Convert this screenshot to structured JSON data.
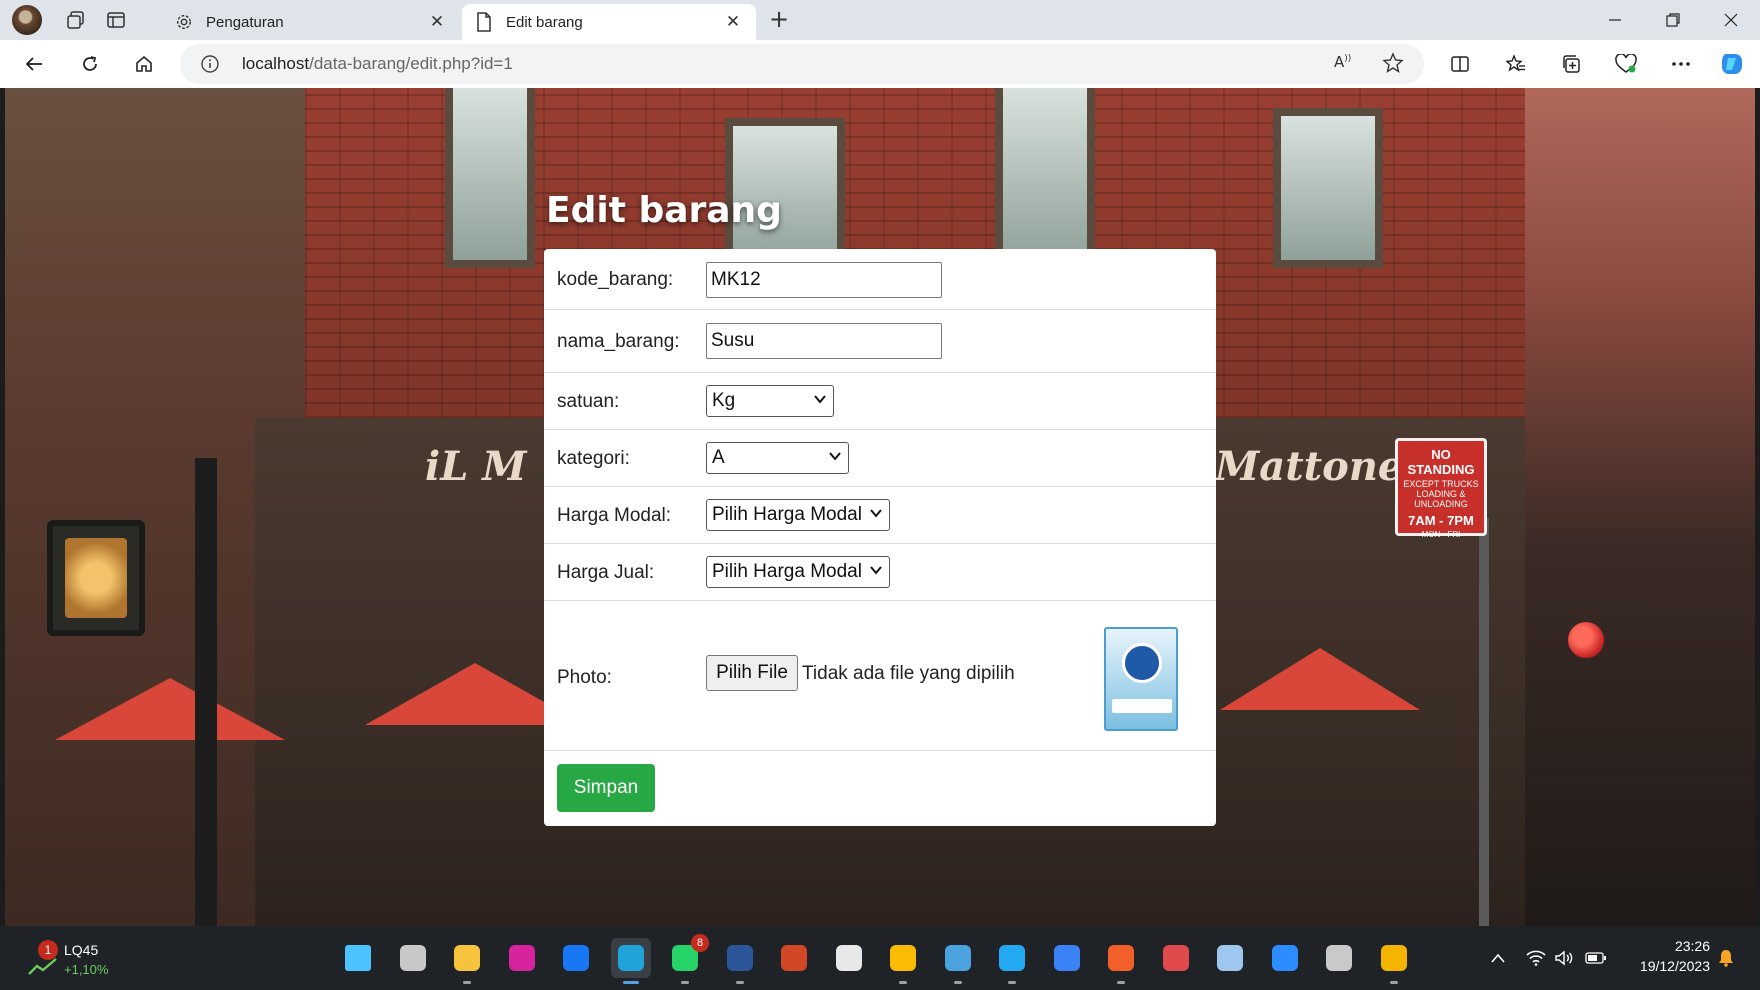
{
  "browser": {
    "tabs": [
      {
        "title": "Pengaturan",
        "icon": "gear-icon",
        "active": false
      },
      {
        "title": "Edit barang",
        "icon": "page-icon",
        "active": true
      }
    ],
    "url_host": "localhost",
    "url_path": "/data-barang/edit.php?id=1"
  },
  "page": {
    "title": "Edit barang",
    "form": {
      "kode_barang": {
        "label": "kode_barang:",
        "value": "MK12"
      },
      "nama_barang": {
        "label": "nama_barang:",
        "value": "Susu"
      },
      "satuan": {
        "label": "satuan:",
        "selected": "Kg"
      },
      "kategori": {
        "label": "kategori:",
        "selected": "A"
      },
      "harga_modal": {
        "label": "Harga Modal:",
        "selected": "Pilih Harga Modal"
      },
      "harga_jual": {
        "label": "Harga Jual:",
        "selected": "Pilih Harga Modal"
      },
      "photo": {
        "label": "Photo:",
        "button": "Pilih File",
        "status": "Tidak ada file yang dipilih"
      },
      "submit": "Simpan"
    },
    "background_signs": {
      "left": "iL M",
      "right": "Mattone",
      "no_standing": [
        "NO STANDING",
        "EXCEPT TRUCKS LOADING & UNLOADING",
        "7AM - 7PM",
        "MON - FRI"
      ]
    }
  },
  "taskbar": {
    "stock": {
      "name": "LQ45",
      "change": "+1,10%",
      "badge": "1"
    },
    "apps": [
      {
        "name": "start",
        "color": "#4cc2ff"
      },
      {
        "name": "task-view",
        "color": "#c8c8c8"
      },
      {
        "name": "file-explorer",
        "color": "#f6c33c"
      },
      {
        "name": "instagram",
        "color": "#d6249f"
      },
      {
        "name": "facebook",
        "color": "#1877f2"
      },
      {
        "name": "edge",
        "color": "#1fa3d9",
        "active": true
      },
      {
        "name": "whatsapp",
        "color": "#25d366",
        "badge": "8"
      },
      {
        "name": "word",
        "color": "#2b579a"
      },
      {
        "name": "powerpoint",
        "color": "#d24726"
      },
      {
        "name": "store",
        "color": "#e8e8e8"
      },
      {
        "name": "chrome",
        "color": "#fbbc05"
      },
      {
        "name": "cloud",
        "color": "#4aa3df"
      },
      {
        "name": "vscode",
        "color": "#23a9f2"
      },
      {
        "name": "app-a",
        "color": "#3b82f6"
      },
      {
        "name": "paint",
        "color": "#f2602a"
      },
      {
        "name": "git",
        "color": "#e04a4a"
      },
      {
        "name": "cube",
        "color": "#9ec7f0"
      },
      {
        "name": "zoom",
        "color": "#2d8cff"
      },
      {
        "name": "obs",
        "color": "#c9c9c9"
      },
      {
        "name": "diamond-app",
        "color": "#f4b400"
      }
    ],
    "time": "23:26",
    "date": "19/12/2023"
  }
}
